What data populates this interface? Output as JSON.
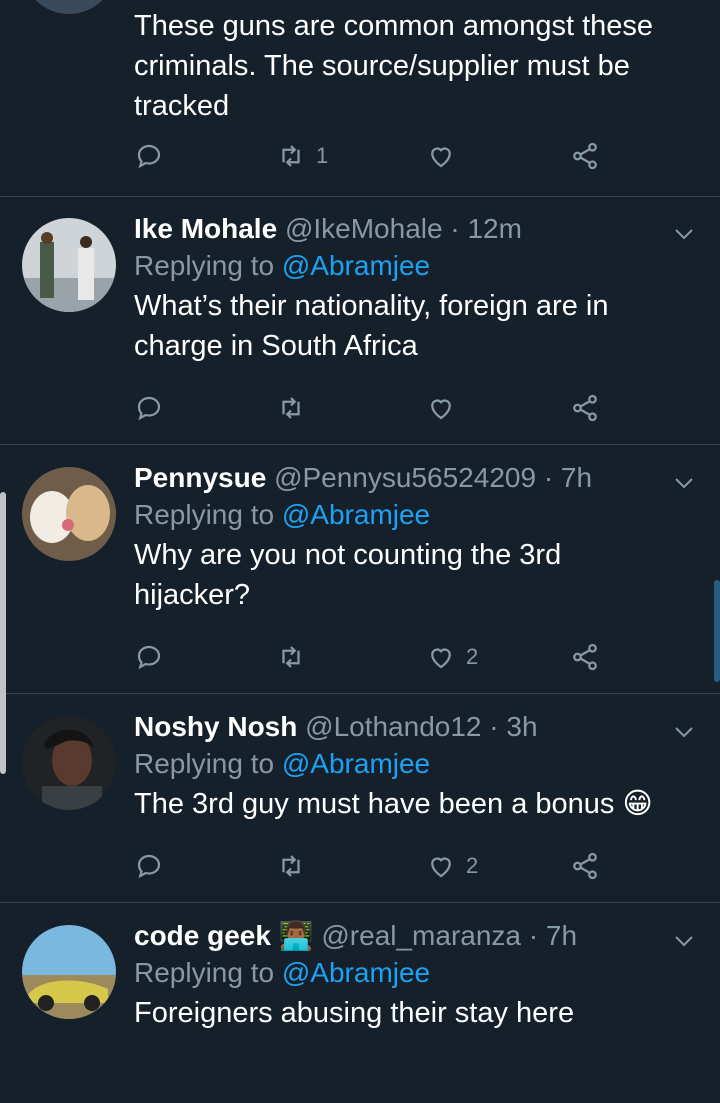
{
  "top_tweet": {
    "text": "These guns are common amongst these criminals. The source/supplier must be tracked",
    "retweets": "1",
    "likes": ""
  },
  "replies": [
    {
      "name": "Ike Mohale",
      "handle": "@IkeMohale",
      "time": "· 12m",
      "replying_prefix": "Replying to",
      "replying_to": "@Abramjee",
      "text": "What’s their nationality, foreign are in charge in South Africa",
      "retweets": "",
      "likes": ""
    },
    {
      "name": "Pennysue",
      "handle": "@Pennysu56524209",
      "time": "· 7h",
      "replying_prefix": "Replying to",
      "replying_to": "@Abramjee",
      "text": "Why are you not counting the 3rd hijacker?",
      "retweets": "",
      "likes": "2"
    },
    {
      "name": "Noshy Nosh",
      "handle": "@Lothando12",
      "time": "· 3h",
      "replying_prefix": "Replying to",
      "replying_to": "@Abramjee",
      "text": "The 3rd guy must have been a bonus 😁",
      "retweets": "",
      "likes": "2"
    },
    {
      "name": "code geek 👨🏾‍💻",
      "handle": "@real_maranza",
      "time": "· 7h",
      "replying_prefix": "Replying to",
      "replying_to": "@Abramjee",
      "text": "Foreigners abusing their stay here",
      "retweets": "",
      "likes": ""
    }
  ],
  "colors": {
    "background": "#15202b",
    "secondary_text": "#8899a6",
    "link": "#1da1f2",
    "divider": "#38444d"
  },
  "icons": [
    "reply-icon",
    "retweet-icon",
    "like-icon",
    "share-icon",
    "chevron-down-icon"
  ]
}
